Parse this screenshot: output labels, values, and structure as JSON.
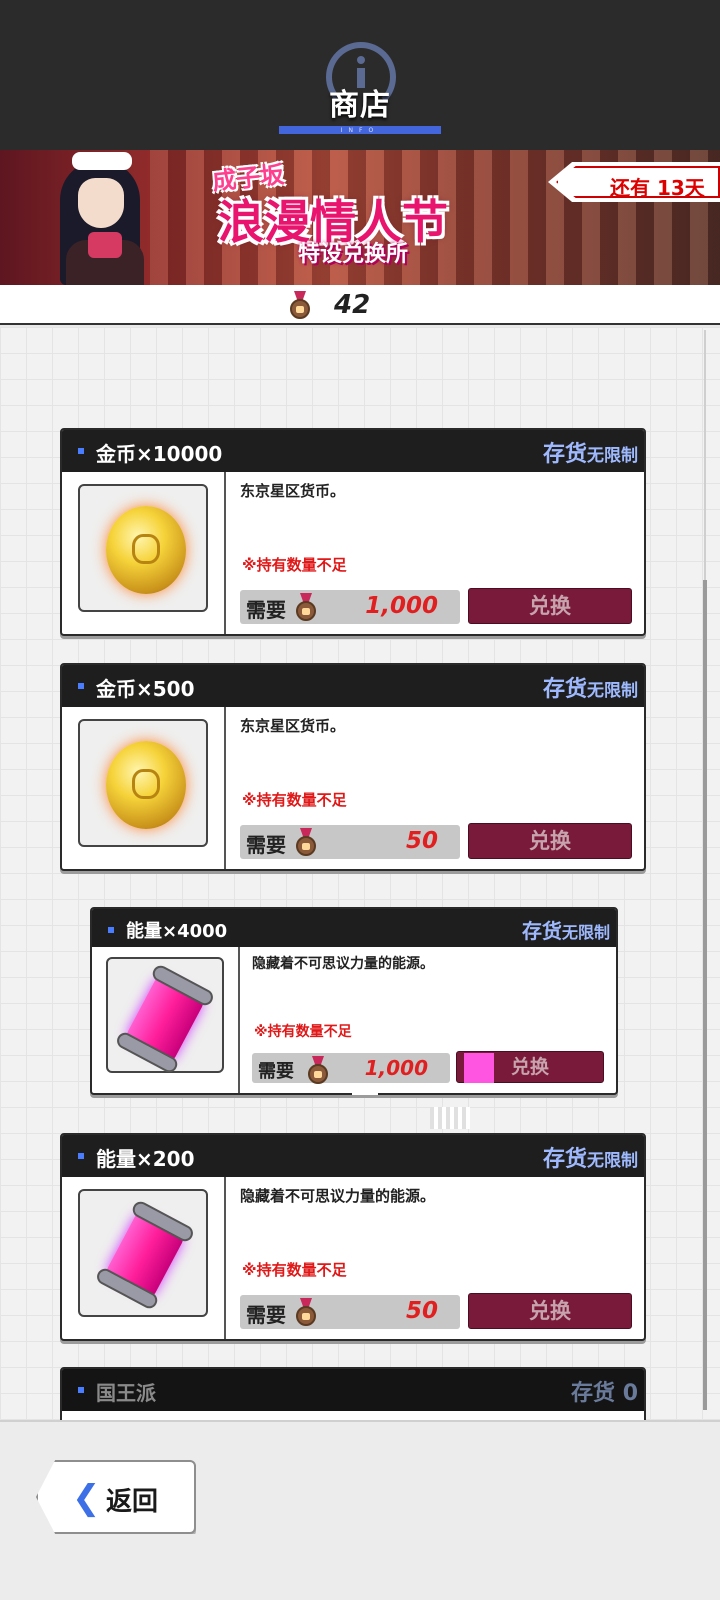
{
  "header": {
    "title": "商店",
    "subtitle": "INFO"
  },
  "banner": {
    "event_line1": "成子坂",
    "event_line2": "浪漫情人节",
    "event_line3": "特设兑换所",
    "time_left": "还有 13天"
  },
  "currency": {
    "amount": "42",
    "icon": "heart-medal-icon"
  },
  "items": [
    {
      "name": "金币×10000",
      "stock_label": "存货",
      "stock_value": "无限制",
      "desc": "东京星区货币。",
      "warning": "※持有数量不足",
      "cost_label": "需要",
      "cost": "1,000",
      "button": "兑换",
      "icon": "gold-coin-icon"
    },
    {
      "name": "金币×500",
      "stock_label": "存货",
      "stock_value": "无限制",
      "desc": "东京星区货币。",
      "warning": "※持有数量不足",
      "cost_label": "需要",
      "cost": "50",
      "button": "兑换",
      "icon": "gold-coin-icon"
    },
    {
      "name": "能量×4000",
      "stock_label": "存货",
      "stock_value": "无限制",
      "desc": "隐藏着不可思议力量的能源。",
      "warning": "※持有数量不足",
      "cost_label": "需要",
      "cost": "1,000",
      "button": "兑换",
      "icon": "energy-canister-icon"
    },
    {
      "name": "能量×200",
      "stock_label": "存货",
      "stock_value": "无限制",
      "desc": "隐藏着不可思议力量的能源。",
      "warning": "※持有数量不足",
      "cost_label": "需要",
      "cost": "50",
      "button": "兑换",
      "icon": "energy-canister-icon"
    },
    {
      "name": "国王派",
      "stock_label": "存货",
      "stock_value": "0"
    }
  ],
  "footer": {
    "back_label": "返回"
  },
  "colors": {
    "accent_blue": "#4466dd",
    "exchange_button": "#7a1a3a",
    "warning_red": "#e01818",
    "cost_red": "#e02020"
  }
}
